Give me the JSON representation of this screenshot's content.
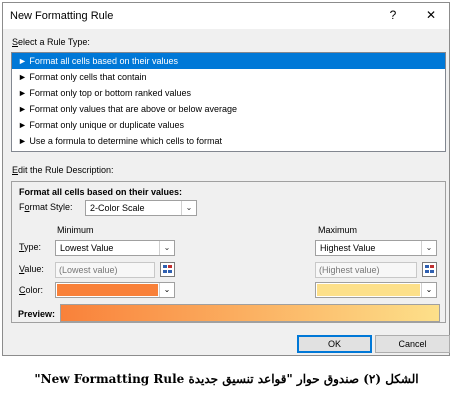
{
  "dialog": {
    "title": "New Formatting Rule",
    "help_glyph": "?",
    "close_glyph": "✕"
  },
  "rule_type": {
    "label_key": "S",
    "label_rest": "elect a Rule Type:",
    "items": [
      "► Format all cells based on their values",
      "► Format only cells that contain",
      "► Format only top or bottom ranked values",
      "► Format only values that are above or below average",
      "► Format only unique or duplicate values",
      "► Use a formula to determine which cells to format"
    ],
    "selected_index": 0
  },
  "description": {
    "label_key": "E",
    "label_rest": "dit the Rule Description:",
    "heading": "Format all cells based on their values:",
    "format_style_key": "o",
    "format_style_pre": "F",
    "format_style_post": "rmat Style:",
    "format_style_value": "2-Color Scale",
    "minimum": {
      "header": "Minimum",
      "type": "Lowest Value",
      "value_placeholder": "(Lowest value)",
      "color": "#f9813a"
    },
    "maximum": {
      "header": "Maximum",
      "type": "Highest Value",
      "value_placeholder": "(Highest value)",
      "color": "#fde08a"
    },
    "type_key": "T",
    "type_rest": "ype:",
    "value_key": "V",
    "value_rest": "alue:",
    "color_key": "C",
    "color_rest": "olor:",
    "preview_label": "Preview:"
  },
  "buttons": {
    "ok": "OK",
    "cancel": "Cancel"
  },
  "caption": "الشكل (٢) صندوق حوار \"قواعد تنسيق جديدة New Formatting Rule\""
}
